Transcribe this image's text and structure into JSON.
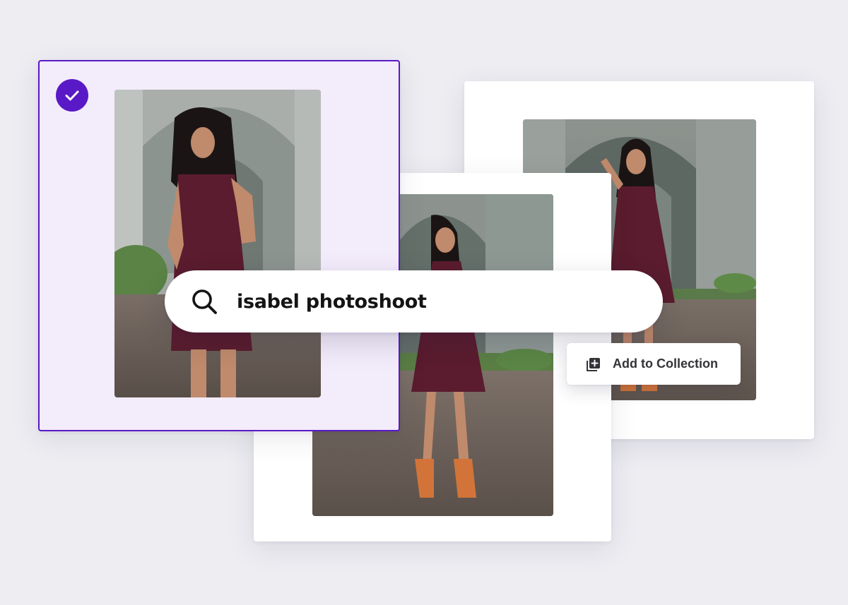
{
  "search": {
    "query": "isabel photoshoot"
  },
  "actions": {
    "add_to_collection_label": "Add to Collection"
  },
  "photos": [
    {
      "id": "photo-1",
      "selected": true,
      "subject": "woman in burgundy dress, hand at shoulder"
    },
    {
      "id": "photo-2",
      "selected": false,
      "subject": "woman in burgundy dress, looking down, orange heels"
    },
    {
      "id": "photo-3",
      "selected": false,
      "subject": "woman in burgundy dress, hand in hair"
    }
  ],
  "colors": {
    "accent": "#5a19c6",
    "selected_card_bg": "#f3ecfb",
    "page_bg": "#ededf2",
    "dress": "#5a1c2e"
  },
  "icons": {
    "selection": "check-icon",
    "search": "search-icon",
    "collection": "collection-add-icon"
  }
}
